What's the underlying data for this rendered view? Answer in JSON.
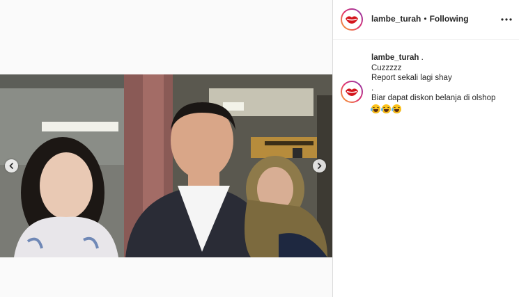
{
  "post": {
    "username": "lambe_turah",
    "separator": "•",
    "follow_status": "Following",
    "more_icon": "more-options-icon"
  },
  "caption": {
    "username": "lambe_turah",
    "username_suffix": " .",
    "lines": [
      "Cuzzzzz",
      "Report sekali lagi shay",
      ".",
      "Biar dapat diskon belanja di olshop"
    ],
    "emojis": [
      "face-with-tears-of-joy",
      "face-with-tears-of-joy",
      "face-with-tears-of-joy"
    ]
  },
  "media": {
    "type": "video-frame",
    "carousel_left_icon": "chevron-left-icon",
    "carousel_right_icon": "chevron-right-icon"
  },
  "colors": {
    "avatar_ring": "#e1306c",
    "text": "#262626",
    "border": "#dbdbdb"
  }
}
